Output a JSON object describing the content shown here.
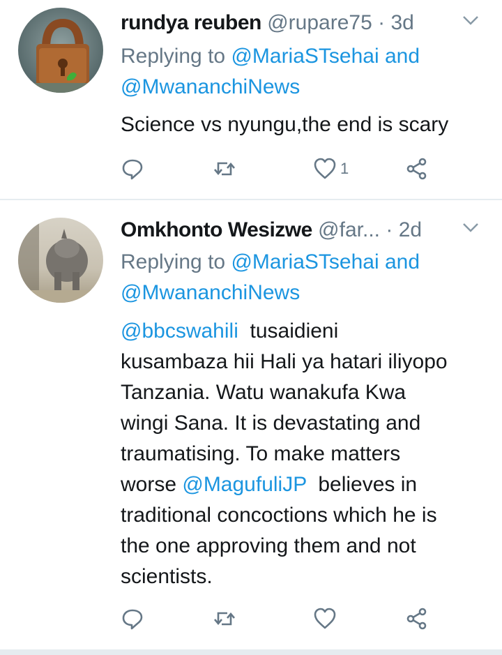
{
  "tweets": [
    {
      "name": "rundya  reuben",
      "handle": "@rupare75",
      "dot": "·",
      "time": "3d",
      "replying_prefix": "Replying to ",
      "replying_to_1": "@MariaSTsehai",
      "replying_and": " and",
      "replying_to_2": "@MwananchiNews",
      "text": "Science vs nyungu,the end is scary",
      "like_count": "1",
      "avatar_icon": "padlock-image"
    },
    {
      "name": "Omkhonto Wesizwe",
      "handle": "@far...",
      "dot": "·",
      "time": "2d",
      "replying_prefix": "Replying to ",
      "replying_to_1": "@MariaSTsehai",
      "replying_and": " and",
      "replying_to_2": "@MwananchiNews",
      "text_mention_1": "@bbcswahili",
      "text_part_1": "  tusaidieni\nkusambaza hii Hali ya hatari iliyopo\nTanzania. Watu wanakufa Kwa\nwingi Sana. It is devastating and\ntraumatising. To make matters\nworse ",
      "text_mention_2": "@MagufuliJP",
      "text_part_2": "  believes in\ntraditional concoctions which he is\nthe one approving them and not\nscientists.",
      "like_count": "",
      "avatar_icon": "rhino-image"
    }
  ],
  "colors": {
    "link": "#1b95e0",
    "secondary": "#657786",
    "text": "#14171a",
    "separator": "#e6ecf0"
  },
  "icons": [
    "reply-icon",
    "retweet-icon",
    "like-icon",
    "share-icon",
    "chevron-down-icon"
  ]
}
